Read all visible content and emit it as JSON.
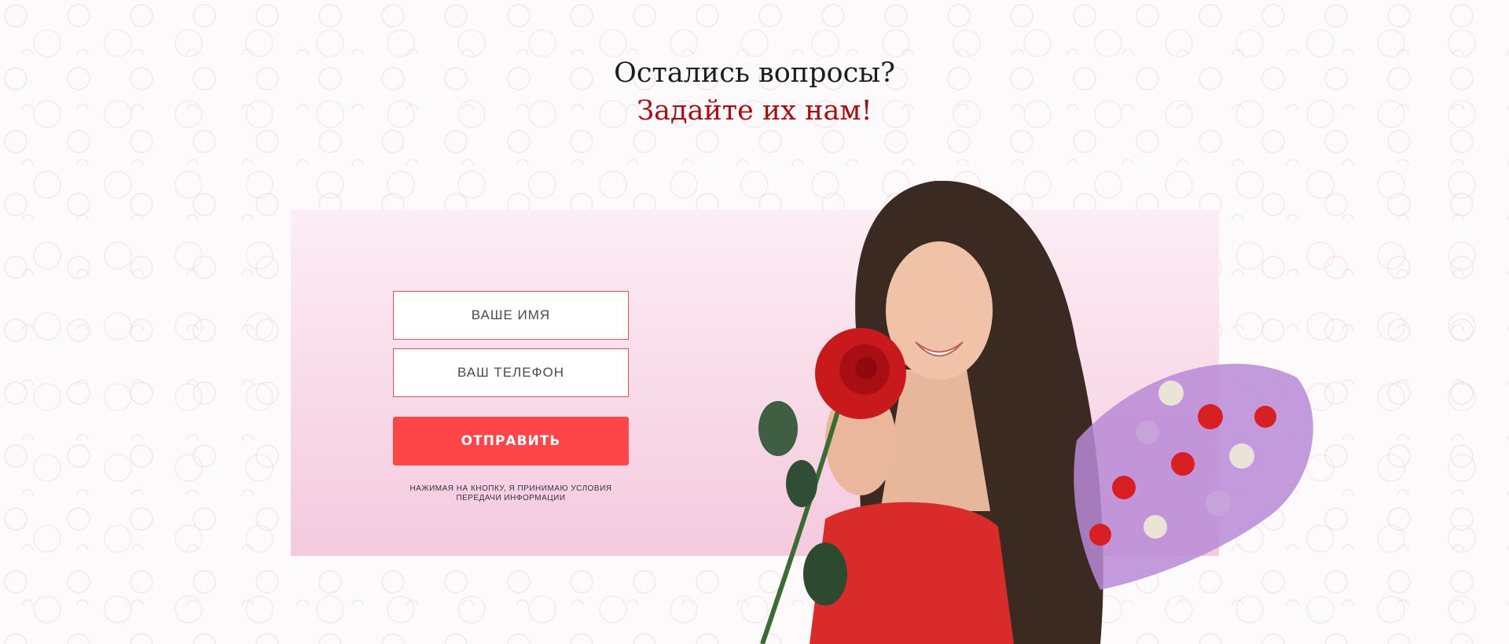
{
  "heading": {
    "line1": "Остались вопросы?",
    "line2": "Задайте их нам!"
  },
  "form": {
    "name_placeholder": "ВАШЕ ИМЯ",
    "phone_placeholder": "ВАШ ТЕЛЕФОН",
    "submit_label": "ОТПРАВИТЬ",
    "consent_line1": "НАЖИМАЯ НА КНОПКУ, Я ПРИНИМАЮ УСЛОВИЯ",
    "consent_line2": "ПЕРЕДАЧИ ИНФОРМАЦИИ"
  },
  "colors": {
    "accent": "#fe4548",
    "heading_dark": "#1c1c1c",
    "heading_accent": "#a60d12",
    "panel_pink": "#f8dae8"
  },
  "illustration": {
    "subject": "woman-with-roses-photo",
    "bouquet": "tulip-bouquet-image"
  }
}
